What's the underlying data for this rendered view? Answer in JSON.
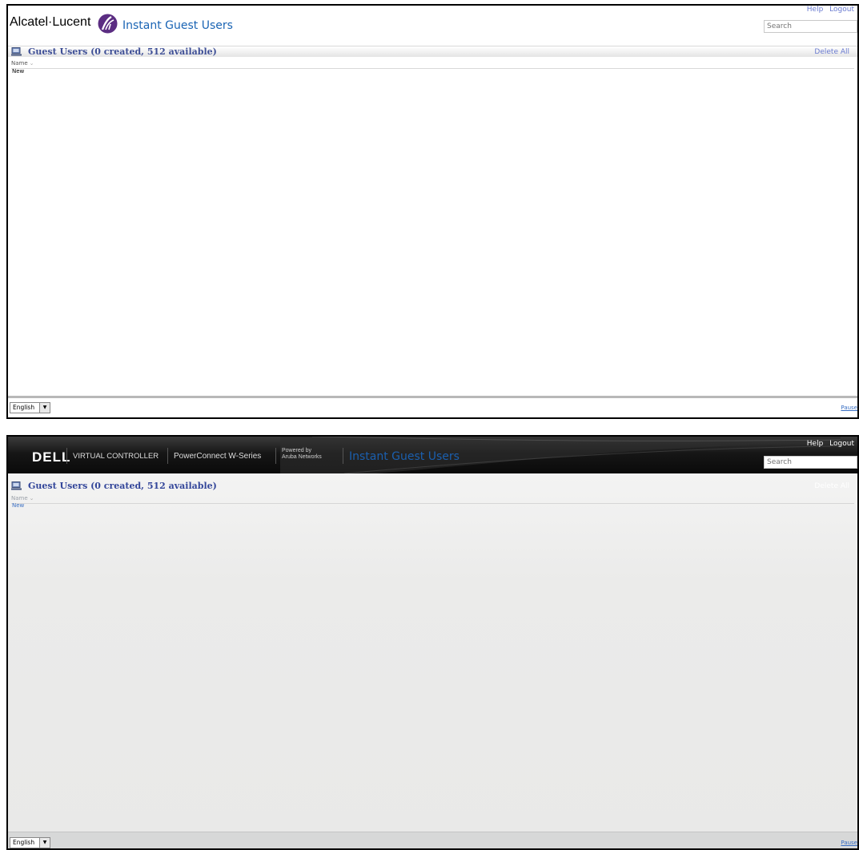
{
  "alcatel": {
    "brand": "Alcatel·Lucent",
    "app_title": "Instant Guest Users",
    "help": "Help",
    "logout": "Logout",
    "search_placeholder": "Search",
    "section_title": "Guest Users (0 created, 512 available)",
    "delete_all": "Delete All",
    "column_name": "Name",
    "new_link": "New",
    "language": "English",
    "pause": "Pause"
  },
  "dell": {
    "brand": "DELL",
    "product": "VIRTUAL CONTROLLER",
    "series": "PowerConnect W-Series",
    "powered_line1": "Powered by",
    "powered_line2": "Aruba Networks",
    "app_title": "Instant Guest Users",
    "help": "Help",
    "logout": "Logout",
    "search_placeholder": "Search",
    "section_title": "Guest Users (0 created, 512 available)",
    "delete_all": "Delete All",
    "column_name": "Name",
    "new_link": "New",
    "language": "English",
    "pause": "Pause"
  },
  "colors": {
    "alcatel_title": "#1a64b4",
    "alcatel_section": "#3e4f96",
    "dell_header_bg": "#0a0a0a",
    "dell_title": "#1b5fae",
    "link_blue": "#3a6fc3"
  }
}
